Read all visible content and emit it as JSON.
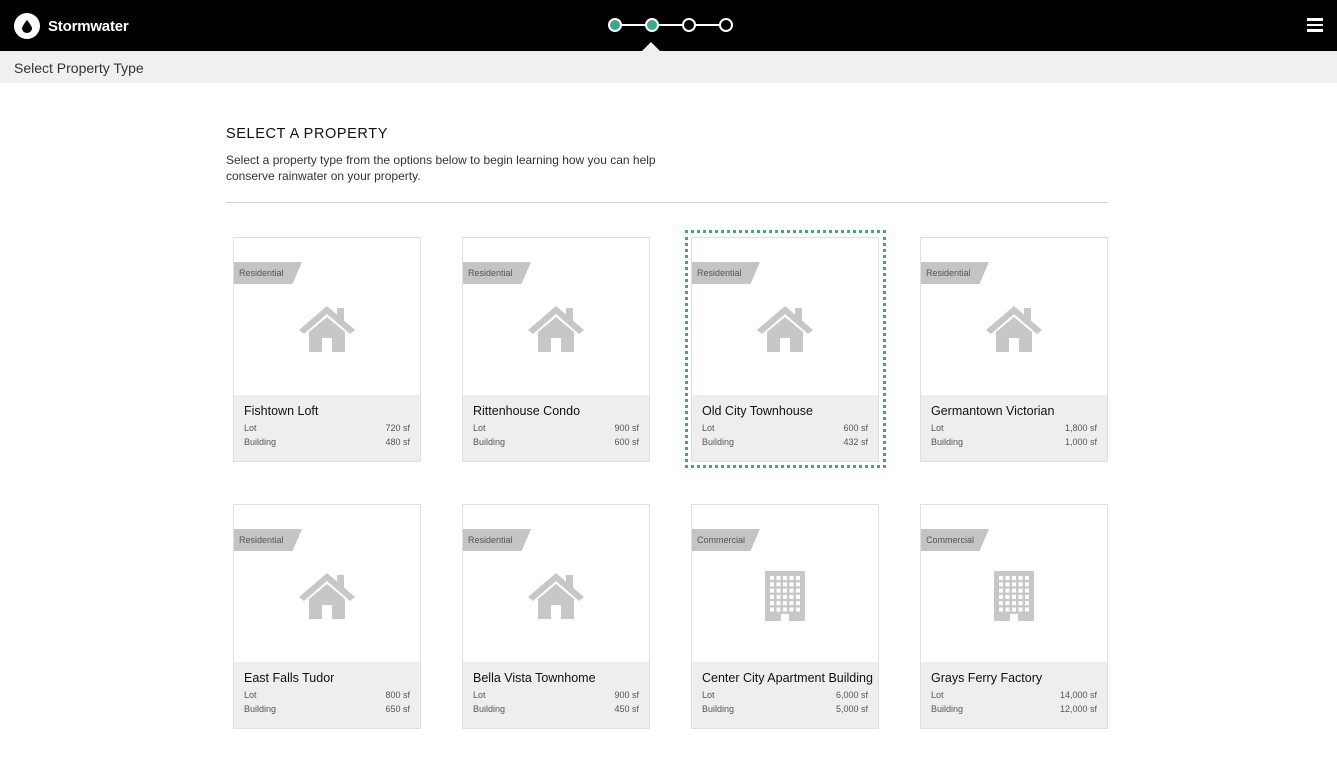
{
  "header": {
    "app_name": "Stormwater",
    "logo_icon": "water-drop-icon",
    "menu_icon": "hamburger-menu-icon",
    "steps": [
      {
        "state": "done"
      },
      {
        "state": "current"
      },
      {
        "state": "todo"
      },
      {
        "state": "todo"
      }
    ],
    "step_color": "#3aa88a"
  },
  "subheader": {
    "title": "Select Property Type"
  },
  "main": {
    "heading": "SELECT A PROPERTY",
    "intro": "Select a property type from the options below to begin learning how you can help conserve rainwater on your property.",
    "lot_label": "Lot",
    "building_label": "Building",
    "properties": [
      {
        "category": "Residential",
        "icon": "house-icon",
        "name": "Fishtown Loft",
        "lot": "720 sf",
        "building": "480 sf",
        "selected": false
      },
      {
        "category": "Residential",
        "icon": "house-icon",
        "name": "Rittenhouse Condo",
        "lot": "900 sf",
        "building": "600 sf",
        "selected": false
      },
      {
        "category": "Residential",
        "icon": "house-icon",
        "name": "Old City Townhouse",
        "lot": "600 sf",
        "building": "432 sf",
        "selected": true
      },
      {
        "category": "Residential",
        "icon": "house-icon",
        "name": "Germantown Victorian",
        "lot": "1,800 sf",
        "building": "1,000 sf",
        "selected": false
      },
      {
        "category": "Residential",
        "icon": "house-icon",
        "name": "East Falls Tudor",
        "lot": "800 sf",
        "building": "650 sf",
        "selected": false
      },
      {
        "category": "Residential",
        "icon": "house-icon",
        "name": "Bella Vista Townhome",
        "lot": "900 sf",
        "building": "450 sf",
        "selected": false
      },
      {
        "category": "Commercial",
        "icon": "office-building-icon",
        "name": "Center City Apartment Building",
        "lot": "6,000 sf",
        "building": "5,000 sf",
        "selected": false
      },
      {
        "category": "Commercial",
        "icon": "office-building-icon",
        "name": "Grays Ferry Factory",
        "lot": "14,000 sf",
        "building": "12,000 sf",
        "selected": false
      }
    ]
  }
}
